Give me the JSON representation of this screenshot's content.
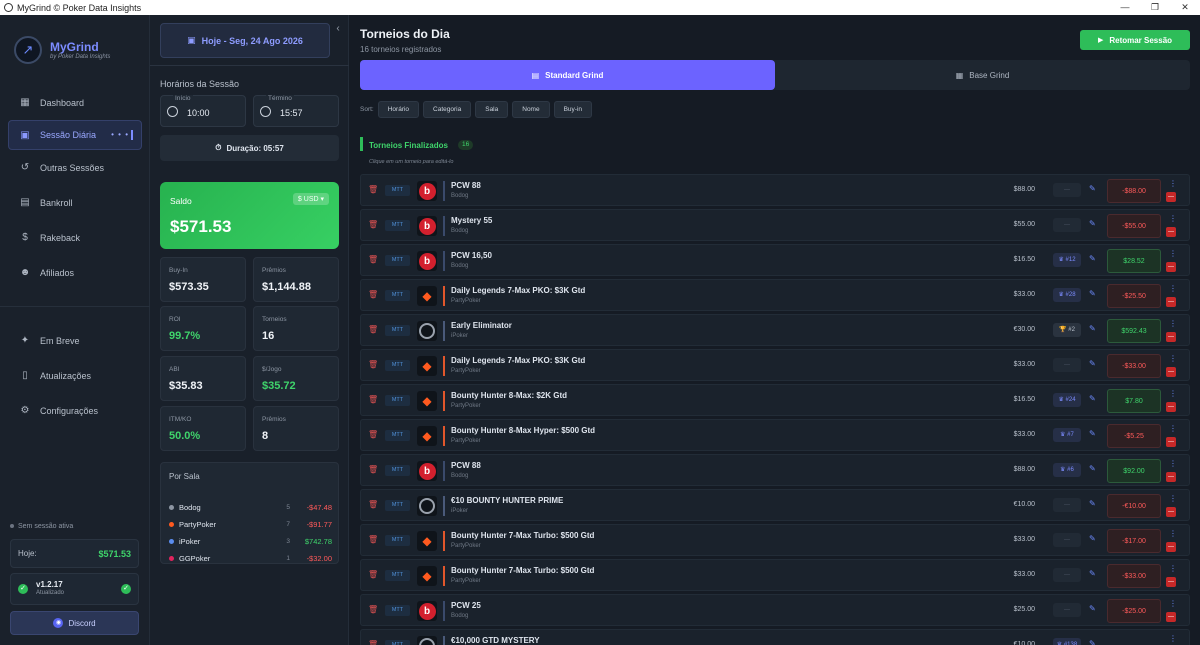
{
  "window": {
    "title": "MyGrind © Poker Data Insights",
    "controls": [
      "—",
      "❐",
      "✕"
    ]
  },
  "brand": {
    "name": "MyGrind",
    "tagline": "by Poker Data Insights"
  },
  "nav": {
    "items": [
      {
        "label": "Dashboard",
        "icon": "dashboard-icon",
        "glyph": "▦"
      },
      {
        "label": "Sessão Diária",
        "icon": "calendar-icon",
        "glyph": "▣",
        "active": true
      },
      {
        "label": "Outras Sessões",
        "icon": "history-icon",
        "glyph": "↺"
      },
      {
        "label": "Bankroll",
        "icon": "wallet-icon",
        "glyph": "▤"
      },
      {
        "label": "Rakeback",
        "icon": "dollar-icon",
        "glyph": "$"
      },
      {
        "label": "Afiliados",
        "icon": "users-icon",
        "glyph": "☻"
      }
    ],
    "items2": [
      {
        "label": "Em Breve",
        "icon": "sparkle-icon",
        "glyph": "✦"
      },
      {
        "label": "Atualizações",
        "icon": "phone-icon",
        "glyph": "▯"
      },
      {
        "label": "Configurações",
        "icon": "gear-icon",
        "glyph": "⚙"
      }
    ]
  },
  "side_footer": {
    "status": "Sem sessão ativa",
    "today_label": "Hoje:",
    "today_value": "$571.53",
    "version": "v1.2.17",
    "version_status": "Atualizado",
    "discord": "Discord"
  },
  "session": {
    "date": "Hoje - Seg, 24 Ago 2026",
    "hours_label": "Horários da Sessão",
    "start_label": "Início",
    "start": "10:00",
    "end_label": "Término",
    "end": "15:57",
    "duration": "Duração: 05:57",
    "saldo_label": "Saldo",
    "currency": "$ USD ▾",
    "saldo": "$571.53",
    "stats": [
      {
        "label": "Buy-In",
        "value": "$573.35",
        "green": false
      },
      {
        "label": "Prêmios",
        "value": "$1,144.88",
        "green": false
      },
      {
        "label": "ROI",
        "value": "99.7%",
        "green": true
      },
      {
        "label": "Torneios",
        "value": "16",
        "green": false
      },
      {
        "label": "ABI",
        "value": "$35.83",
        "green": false
      },
      {
        "label": "$/Jogo",
        "value": "$35.72",
        "green": true
      },
      {
        "label": "ITM/KO",
        "value": "50.0%",
        "green": true
      },
      {
        "label": "Prêmios",
        "value": "8",
        "green": false
      }
    ],
    "by_room_title": "Por Sala",
    "by_room": [
      {
        "name": "Bodog",
        "count": "5",
        "amount": "-$47.48",
        "color": "#8d96a3",
        "neg": true
      },
      {
        "name": "PartyPoker",
        "count": "7",
        "amount": "-$91.77",
        "color": "#ff5a1f",
        "neg": true
      },
      {
        "name": "iPoker",
        "count": "3",
        "amount": "$742.78",
        "color": "#5b8def",
        "neg": false
      },
      {
        "name": "GGPoker",
        "count": "1",
        "amount": "-$32.00",
        "color": "#e0245e",
        "neg": true
      }
    ]
  },
  "main": {
    "title": "Torneios do Dia",
    "subtitle": "16 torneios registrados",
    "resume_button": "Retomar Sessão",
    "tabs": [
      "Standard Grind",
      "Base Grind"
    ],
    "sort_label": "Sort:",
    "sort_buttons": [
      "Horário",
      "Categoria",
      "Sala",
      "Nome",
      "Buy-in"
    ],
    "section_title": "Torneios Finalizados",
    "section_count": "16",
    "hint": "Clique em um torneio para editá-lo"
  },
  "tournaments": [
    {
      "name": "PCW 88",
      "site": "Bodog",
      "room": "bodog",
      "buyin": "$88.00",
      "pos": "",
      "result": "-$88.00",
      "neg": true
    },
    {
      "name": "Mystery 55",
      "site": "Bodog",
      "room": "bodog",
      "buyin": "$55.00",
      "pos": "",
      "result": "-$55.00",
      "neg": true
    },
    {
      "name": "PCW 16,50",
      "site": "Bodog",
      "room": "bodog",
      "buyin": "$16.50",
      "pos": "#12",
      "result": "$28.52",
      "neg": false
    },
    {
      "name": "Daily Legends 7-Max PKO: $3K Gtd",
      "site": "PartyPoker",
      "room": "party",
      "buyin": "$33.00",
      "pos": "#28",
      "result": "-$25.50",
      "neg": true
    },
    {
      "name": "Early Eliminator",
      "site": "iPoker",
      "room": "ipoker",
      "buyin": "€30.00",
      "pos": "#2",
      "result": "$592.43",
      "neg": false
    },
    {
      "name": "Daily Legends 7-Max PKO: $3K Gtd",
      "site": "PartyPoker",
      "room": "party",
      "buyin": "$33.00",
      "pos": "",
      "result": "-$33.00",
      "neg": true
    },
    {
      "name": "Bounty Hunter 8-Max: $2K Gtd",
      "site": "PartyPoker",
      "room": "party",
      "buyin": "$16.50",
      "pos": "#24",
      "result": "$7.80",
      "neg": false
    },
    {
      "name": "Bounty Hunter 8-Max Hyper: $500 Gtd",
      "site": "PartyPoker",
      "room": "party",
      "buyin": "$33.00",
      "pos": "#7",
      "result": "-$5.25",
      "neg": true
    },
    {
      "name": "PCW 88",
      "site": "Bodog",
      "room": "bodog",
      "buyin": "$88.00",
      "pos": "#6",
      "result": "$92.00",
      "neg": false
    },
    {
      "name": "€10 BOUNTY HUNTER PRIME",
      "site": "iPoker",
      "room": "ipoker",
      "buyin": "€10.00",
      "pos": "",
      "result": "-€10.00",
      "neg": true
    },
    {
      "name": "Bounty Hunter 7-Max Turbo: $500 Gtd",
      "site": "PartyPoker",
      "room": "party",
      "buyin": "$33.00",
      "pos": "",
      "result": "-$17.00",
      "neg": true
    },
    {
      "name": "Bounty Hunter 7-Max Turbo: $500 Gtd",
      "site": "PartyPoker",
      "room": "party",
      "buyin": "$33.00",
      "pos": "",
      "result": "-$33.00",
      "neg": true
    },
    {
      "name": "PCW 25",
      "site": "Bodog",
      "room": "bodog",
      "buyin": "$25.00",
      "pos": "",
      "result": "-$25.00",
      "neg": true
    },
    {
      "name": "€10,000 GTD MYSTERY",
      "site": "iPoker",
      "room": "ipoker",
      "buyin": "€10.00",
      "pos": "#138",
      "result": "",
      "neg": false
    }
  ],
  "labels": {
    "mtt": "MTT"
  }
}
